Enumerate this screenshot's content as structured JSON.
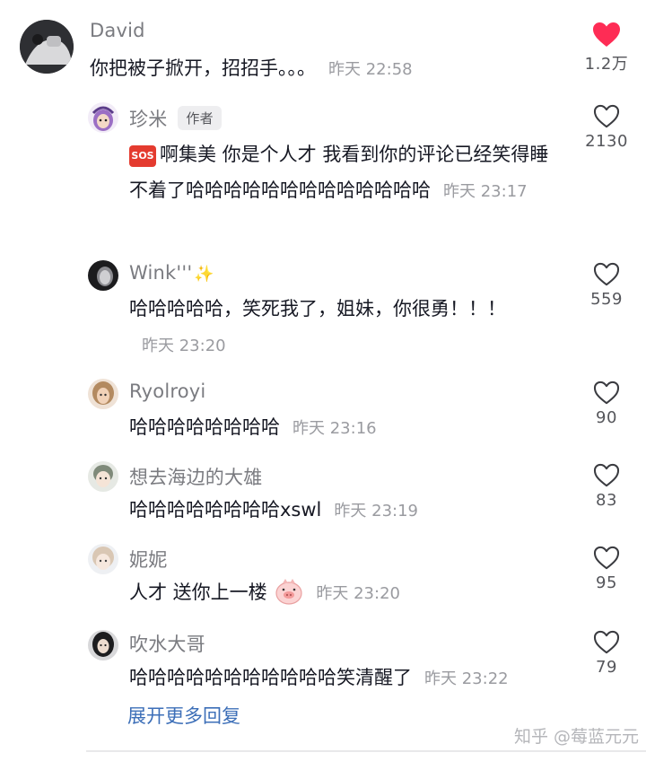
{
  "comments": [
    {
      "name": "David",
      "author_tag": "",
      "text": "你把被子掀开，招招手。。。",
      "time": "昨天 22:58",
      "likes": "1.2万",
      "liked": true
    },
    {
      "name": "珍米",
      "author_tag": "作者",
      "sos": "SOS",
      "text": "啊集美 你是个人才 我看到你的评论已经笑得睡不着了哈哈哈哈哈哈哈哈哈哈哈哈哈",
      "time": "昨天 23:17",
      "likes": "2130"
    },
    {
      "name": "Wink'''",
      "text": "哈哈哈哈哈，笑死我了，姐妹，你很勇！！！",
      "time": "昨天 23:20",
      "likes": "559"
    },
    {
      "name": "Ryolroyi",
      "text": "哈哈哈哈哈哈哈哈",
      "time": "昨天 23:16",
      "likes": "90"
    },
    {
      "name": "想去海边的大雄",
      "text": "哈哈哈哈哈哈哈哈xswl",
      "time": "昨天 23:19",
      "likes": "83"
    },
    {
      "name": "妮妮",
      "text": "人才 送你上一楼",
      "time": "昨天 23:20",
      "likes": "95"
    },
    {
      "name": "吹水大哥",
      "text": "哈哈哈哈哈哈哈哈哈哈哈笑清醒了",
      "time": "昨天 23:22",
      "likes": "79"
    }
  ],
  "expand_label": "展开更多回复",
  "watermark": "知乎 @莓蓝元元",
  "icons": {
    "like_filled": "heart-filled-icon",
    "like_outline": "heart-outline-icon"
  },
  "colors": {
    "heart": "#fe2c55",
    "link": "#3d6fb8"
  }
}
